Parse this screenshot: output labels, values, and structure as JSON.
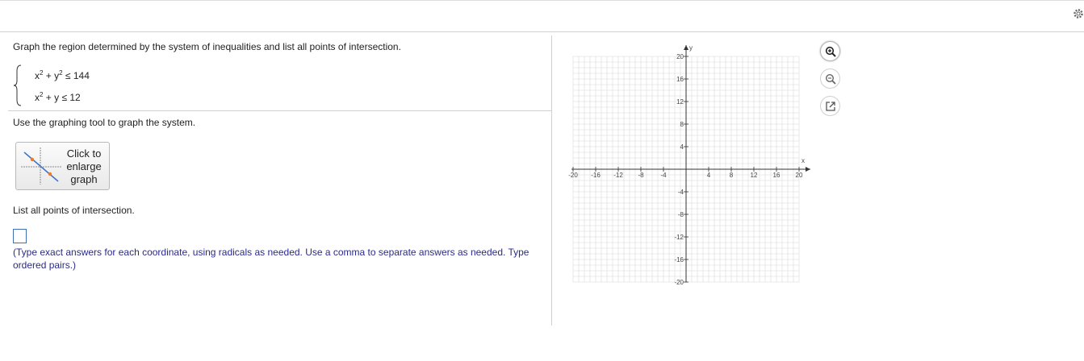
{
  "question": {
    "prompt": "Graph the region determined by the system of inequalities and list all points of intersection.",
    "inequality1": {
      "a": "x",
      "plus1": " + y",
      "rest": " ≤ 144",
      "exp": "2"
    },
    "inequality2": {
      "a": "x",
      "rest": " + y ≤ 12",
      "exp": "2"
    }
  },
  "instructions": "Use the graphing tool to graph the system.",
  "enlarge_button": {
    "line1": "Click to",
    "line2": "enlarge",
    "line3": "graph"
  },
  "list_label": "List all points of intersection.",
  "hint": "(Type exact answers for each coordinate, using radicals as needed. Use a comma to separate answers as needed. Type ordered pairs.)",
  "graph": {
    "x_label": "x",
    "y_label": "y",
    "x_range": [
      -20,
      20
    ],
    "y_range": [
      -20,
      20
    ],
    "x_ticks": [
      "-20",
      "-16",
      "-12",
      "-8",
      "-4",
      "4",
      "8",
      "12",
      "16",
      "20"
    ],
    "y_ticks": [
      "20",
      "16",
      "12",
      "8",
      "4",
      "-4",
      "-8",
      "-12",
      "-16",
      "-20"
    ],
    "grid": true
  },
  "tools": [
    "zoom-in-icon",
    "zoom-out-icon",
    "pop-out-icon"
  ],
  "colors": {
    "hint_text": "#2a2a8c",
    "answer_border": "#3d6fb5",
    "grid": "#d8d8d8"
  }
}
